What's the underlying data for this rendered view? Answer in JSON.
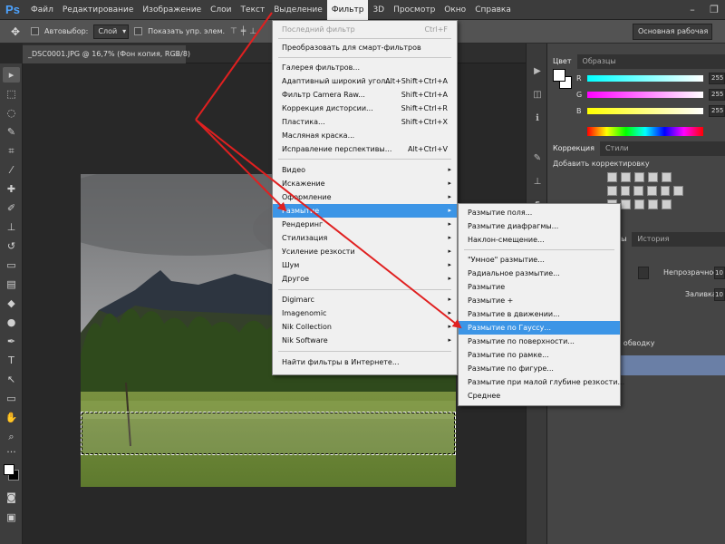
{
  "app": {
    "logo": "Ps"
  },
  "menubar": {
    "items": [
      "Файл",
      "Редактирование",
      "Изображение",
      "Слои",
      "Текст",
      "Выделение",
      "Фильтр",
      "3D",
      "Просмотр",
      "Окно",
      "Справка"
    ],
    "active_index": 6
  },
  "window_controls": {
    "minimize": "–",
    "restore": "❐"
  },
  "options": {
    "autoselect_label": "Автовыбор:",
    "autoselect_value": "Слой",
    "show_controls_label": "Показать упр. элем.",
    "workspace": "Основная рабочая среда"
  },
  "document": {
    "tab_title": "_DSC0001.JPG @ 16,7% (Фон копия, RGB/8)",
    "close": "×"
  },
  "filter_menu": {
    "last_filter": "Последний фильтр",
    "last_filter_shortcut": "Ctrl+F",
    "smart": "Преобразовать для смарт-фильтров",
    "gallery": "Галерея фильтров...",
    "adaptive": "Адаптивный широкий угол...",
    "adaptive_shortcut": "Alt+Shift+Ctrl+A",
    "camera_raw": "Фильтр Camera Raw...",
    "camera_raw_shortcut": "Shift+Ctrl+A",
    "lens": "Коррекция дисторсии...",
    "lens_shortcut": "Shift+Ctrl+R",
    "liquify": "Пластика...",
    "liquify_shortcut": "Shift+Ctrl+X",
    "oil": "Масляная краска...",
    "perspective": "Исправление перспективы...",
    "perspective_shortcut": "Alt+Ctrl+V",
    "video": "Видео",
    "distort": "Искажение",
    "stylize_design": "Оформление",
    "blur": "Размытие",
    "render": "Рендеринг",
    "stylize": "Стилизация",
    "sharpen": "Усиление резкости",
    "noise": "Шум",
    "other": "Другое",
    "digimarc": "Digimarc",
    "imagenomic": "Imagenomic",
    "nik_collection": "Nik Collection",
    "nik_software": "Nik Software",
    "browse": "Найти фильтры в Интернете...",
    "arrow": "▸"
  },
  "blur_submenu": {
    "field": "Размытие поля...",
    "iris": "Размытие диафрагмы...",
    "tilt": "Наклон-смещение...",
    "smart": "\"Умное\" размытие...",
    "radial": "Радиальное размытие...",
    "blur": "Размытие",
    "blur_more": "Размытие +",
    "motion": "Размытие в движении...",
    "gaussian": "Размытие по Гауссу...",
    "surface": "Размытие по поверхности...",
    "box": "Размытие по рамке...",
    "shape": "Размытие по фигуре...",
    "lens": "Размытие при малой глубине резкости...",
    "average": "Среднее"
  },
  "color_panel": {
    "tabs": [
      "Цвет",
      "Образцы"
    ],
    "r_label": "R",
    "r_value": "255",
    "g_label": "G",
    "g_value": "255",
    "b_label": "B",
    "b_value": "255"
  },
  "adjustments_panel": {
    "tabs": [
      "Коррекция",
      "Стили"
    ],
    "title": "Добавить корректировку"
  },
  "layers_panel": {
    "tab_partial_1": "ры",
    "tab_partial_2": "История",
    "opacity_label": "Непрозрачность:",
    "opacity_value": "10",
    "fill_label": "Заливка:",
    "fill_value": "10",
    "stroke_partial": "ть обводку"
  },
  "colors": {
    "accent": "#3c95e6",
    "annotation": "#e02020"
  }
}
